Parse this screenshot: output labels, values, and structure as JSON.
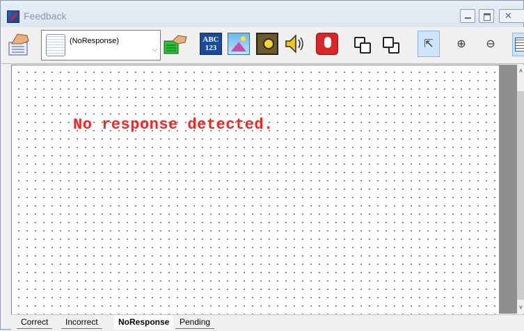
{
  "window": {
    "title": "Feedback"
  },
  "toolbar": {
    "combo_value": "(NoResponse)",
    "text_icon_label": "ABC\n123"
  },
  "canvas": {
    "message": "No response detected.",
    "message_color": "#ff2020"
  },
  "tabs": [
    {
      "label": "Correct",
      "active": false
    },
    {
      "label": "Incorrect",
      "active": false
    },
    {
      "label": "NoResponse",
      "active": true
    },
    {
      "label": "Pending",
      "active": false
    }
  ]
}
